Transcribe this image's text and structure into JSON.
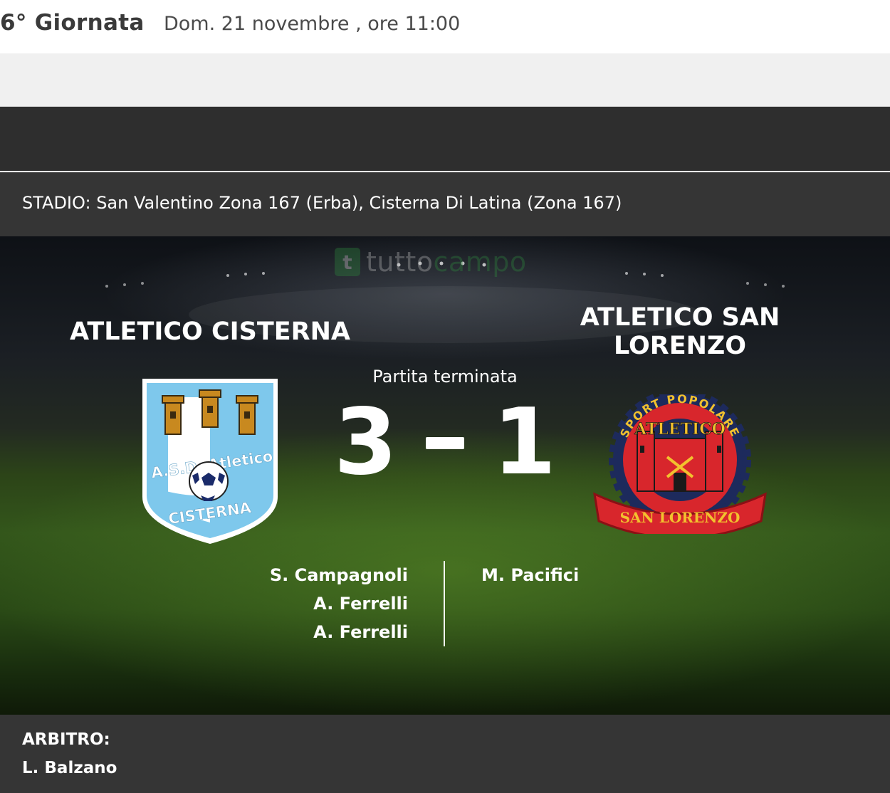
{
  "header": {
    "round": "6° Giornata",
    "datetime": "Dom. 21 novembre , ore 11:00"
  },
  "stadium": "STADIO: San Valentino Zona 167 (Erba), Cisterna Di Latina (Zona 167)",
  "watermark": {
    "letter": "t",
    "word_start": "tutto",
    "word_end": "campo"
  },
  "match": {
    "status": "Partita terminata",
    "home": {
      "name": "ATLETICO CISTERNA",
      "score": "3",
      "crest_text_top": "A.S.D. Atletico",
      "crest_text_bottom": "CISTERNA",
      "scorers": [
        "S. Campagnoli",
        "A. Ferrelli",
        "A. Ferrelli"
      ]
    },
    "away": {
      "name": "ATLETICO SAN LORENZO",
      "score": "1",
      "crest_text_ring": "SPORT POPOLARE",
      "crest_text_main": "ATLETICO",
      "crest_text_banner": "SAN LORENZO",
      "scorers": [
        "M. Pacifici"
      ]
    }
  },
  "referee": {
    "label": "ARBITRO:",
    "name": "L. Balzano"
  },
  "colors": {
    "dark_band": "#2e2e2e",
    "bar": "#353535",
    "home_crest": "#7ec8ec",
    "away_crest_red": "#d8262c",
    "away_crest_navy": "#1d2a5c"
  }
}
